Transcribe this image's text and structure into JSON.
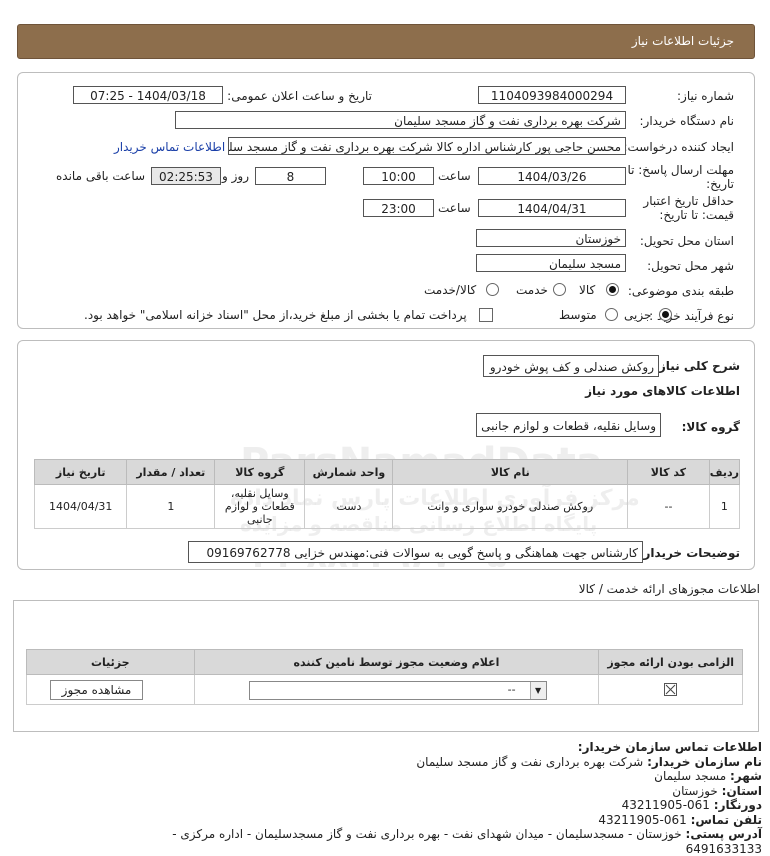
{
  "header": {
    "title": "جزئیات اطلاعات نیاز"
  },
  "fields": {
    "need_number_label": "شماره نیاز:",
    "need_number": "1104093984000294",
    "announce_label": "تاریخ و ساعت اعلان عمومی:",
    "announce_value": "1404/03/18 - 07:25",
    "buyer_org_label": "نام دستگاه خریدار:",
    "buyer_org": "شرکت بهره برداری نفت و گاز مسجد سلیمان",
    "creator_label": "ایجاد کننده درخواست:",
    "creator": "محسن حاجی پور کارشناس اداره کالا  شرکت بهره برداری نفت و گاز مسجد سلیمان",
    "contact_link": "اطلاعات تماس خریدار",
    "deadline_label_1": "مهلت ارسال پاسخ: تا",
    "deadline_label_2": "تاریخ:",
    "deadline_date": "1404/03/26",
    "time_label": "ساعت",
    "deadline_time": "10:00",
    "days_value": "8",
    "days_label": "روز و",
    "remaining_time": "02:25:53",
    "remaining_label": "ساعت باقی مانده",
    "validity_label_1": "حداقل تاریخ اعتبار",
    "validity_label_2": "قیمت: تا تاریخ:",
    "validity_date": "1404/04/31",
    "validity_time": "23:00",
    "province_label": "استان محل تحویل:",
    "province": "خوزستان",
    "city_label": "شهر محل تحویل:",
    "city": "مسجد سلیمان",
    "category_label": "طبقه بندی موضوعی:",
    "cat_goods": "کالا",
    "cat_service": "خدمت",
    "cat_both": "کالا/خدمت",
    "process_label": "نوع فرآیند خرید :",
    "proc_partial": "جزیی",
    "proc_medium": "متوسط",
    "payment_note": "پرداخت تمام یا بخشی از مبلغ خرید،از محل \"اسناد خزانه اسلامی\" خواهد بود."
  },
  "summary": {
    "general_label": "شرح کلی نیاز:",
    "general_value": "روکش صندلی و کف پوش خودرو",
    "goods_info_title": "اطلاعات کالاهای مورد نیاز",
    "group_label": "گروه کالا:",
    "group_value": "وسایل نقلیه، قطعات و لوازم جانبی",
    "table_headers": [
      "ردیف",
      "کد کالا",
      "نام کالا",
      "واحد شمارش",
      "گروه کالا",
      "تعداد / مقدار",
      "تاریخ نیاز"
    ],
    "row": {
      "index": "1",
      "code": "--",
      "name": "روکش صندلی خودرو سواری و وانت",
      "unit": "دست",
      "group": "وسایل نقلیه، قطعات و لوازم جانبی",
      "qty": "1",
      "date": "1404/04/31"
    },
    "buyer_desc_label": "توضیحات خریدار:",
    "buyer_desc": "کارشناس جهت هماهنگی و پاسخ گویی به سوالات فنی:مهندس خزایی 09169762778"
  },
  "permits": {
    "title": "اطلاعات مجوزهای ارائه خدمت / کالا",
    "headers": [
      "الزامی بودن ارائه مجوز",
      "اعلام وضعیت مجوز توسط نامین کننده",
      "جزئیات"
    ],
    "status_value": "--",
    "view_button": "مشاهده مجوز"
  },
  "contact": {
    "title": "اطلاعات تماس سازمان خریدار:",
    "org_label": "نام سازمان خریدار:",
    "org": "شرکت بهره برداری نفت و گاز مسجد سلیمان",
    "city_label": "شهر:",
    "city": "مسجد سلیمان",
    "province_label": "استان:",
    "province": "خوزستان",
    "fax_label": "دورنگار:",
    "fax": "061-43211905",
    "phone_label": "تلفن تماس:",
    "phone": "061-43211905",
    "address_label": "آدرس پستی:",
    "address": "خوزستان - مسجدسلیمان - میدان شهدای نفت - بهره برداری نفت و گاز مسجدسلیمان - اداره مرکزی -",
    "postal_code": "6491633133"
  },
  "watermark": {
    "text1": "ParsNamadData",
    "text2": "مرکز فرآوری اطلاعات پارس نماد داده",
    "text3": "پایگاه اطلاع رسانی مناقصه و مزایده",
    "phone": "۰۲۱-۸۸۳۴۹۶۷۰-۵"
  }
}
